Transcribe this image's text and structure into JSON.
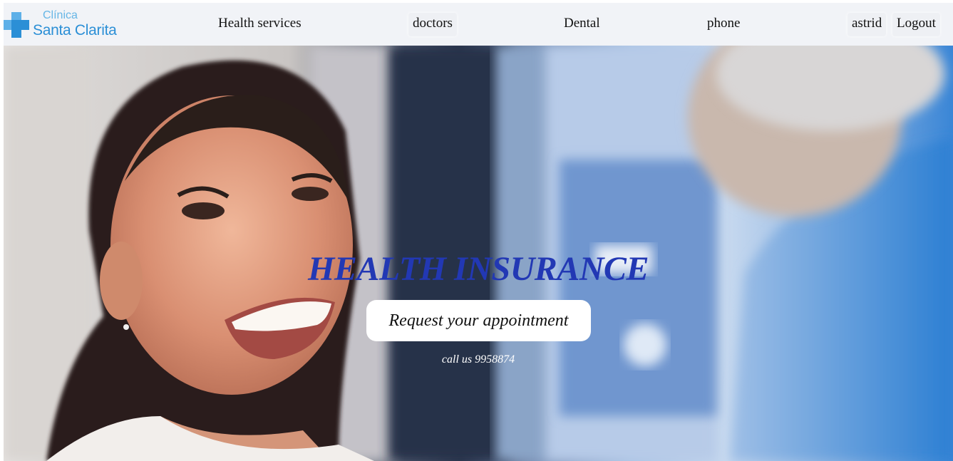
{
  "logo": {
    "line1": "Clínica",
    "line2": "Santa Clarita",
    "color_light": "#66b6e6",
    "color_dark": "#2b8fd6"
  },
  "nav": {
    "health_services": "Health services",
    "doctors": "doctors",
    "dental": "Dental",
    "phone": "phone",
    "user": "astrid",
    "logout": "Logout"
  },
  "hero": {
    "title": "HEALTH INSURANCE",
    "title_color": "#2238b4",
    "cta": "Request your appointment",
    "call": "call us 9958874",
    "image_subject": "smiling woman at dental clinic"
  }
}
